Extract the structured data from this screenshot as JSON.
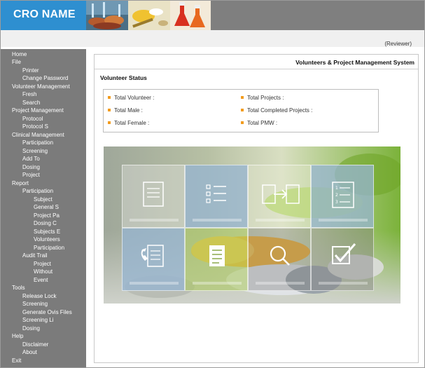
{
  "header": {
    "brand": "CRO NAME",
    "accent": "#2e8fd0"
  },
  "user": {
    "role_label": "(Reviewer)"
  },
  "sidebar": {
    "items": [
      {
        "label": "Home"
      },
      {
        "label": "File"
      },
      {
        "label": "Printer"
      },
      {
        "label": "Change Password"
      },
      {
        "label": "Volunteer Management"
      },
      {
        "label": "Fresh"
      },
      {
        "label": "Search"
      },
      {
        "label": "Project Management"
      },
      {
        "label": "Protocol"
      },
      {
        "label": "Protocol S"
      },
      {
        "label": "Clinical Management"
      },
      {
        "label": "Participation"
      },
      {
        "label": "Screening"
      },
      {
        "label": "Add To"
      },
      {
        "label": "Dosing"
      },
      {
        "label": "Project"
      },
      {
        "label": "Report"
      },
      {
        "label": "Participation"
      },
      {
        "label": "Subject"
      },
      {
        "label": "General S"
      },
      {
        "label": "Project Pa"
      },
      {
        "label": "Dosing C"
      },
      {
        "label": "Subjects E"
      },
      {
        "label": "Volunteers"
      },
      {
        "label": "Participation"
      },
      {
        "label": "Audit Trail"
      },
      {
        "label": "Project"
      },
      {
        "label": "Without"
      },
      {
        "label": "Event"
      },
      {
        "label": "Tools"
      },
      {
        "label": "Release Lock"
      },
      {
        "label": "Screening"
      },
      {
        "label": "Generate Ovis Files"
      },
      {
        "label": "Screening Li"
      },
      {
        "label": "Dosing"
      },
      {
        "label": "Help"
      },
      {
        "label": "Disclaimer"
      },
      {
        "label": "About"
      },
      {
        "label": "Exit"
      }
    ]
  },
  "main": {
    "system_title": "Volunteers & Project Management System",
    "section_title": "Volunteer Status",
    "stats": {
      "total_volunteer": "Total Volunteer :",
      "total_male": "Total Male :",
      "total_female": "Total Female :",
      "total_projects": "Total Projects :",
      "total_completed_projects": "Total Completed Projects :",
      "total_pmw": "Total PMW :"
    },
    "bullet_color": "#f29c1f"
  },
  "hero": {
    "icons": [
      "form-icon",
      "checklist-icon",
      "transfer-icon",
      "numbered-list-icon",
      "phone-document-icon",
      "notes-icon",
      "magnifier-icon",
      "checkbox-icon"
    ]
  }
}
